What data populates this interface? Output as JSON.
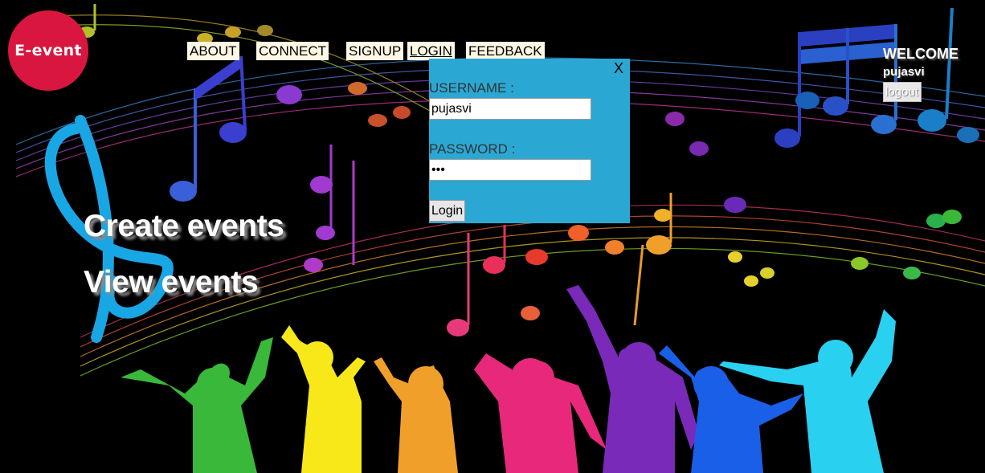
{
  "logo": {
    "text": "E-event"
  },
  "nav": {
    "about": "ABOUT",
    "connect": "CONNECT",
    "signup": "SIGNUP",
    "login": "LOGIN",
    "feedback": "FEEDBACK"
  },
  "user_panel": {
    "welcome": "WELCOME",
    "username": "pujasvi",
    "logout_label": "logout"
  },
  "hero": {
    "create": "Create events",
    "view": "View events"
  },
  "login_modal": {
    "close": "X",
    "username_label": "USERNAME :",
    "username_value": "pujasvi",
    "password_label": "PASSWORD :",
    "password_value": "***",
    "submit_label": "Login"
  },
  "colors": {
    "logo_bg": "#d9163f",
    "nav_bg": "#fdf7e4",
    "modal_bg": "#2aa8d3"
  }
}
